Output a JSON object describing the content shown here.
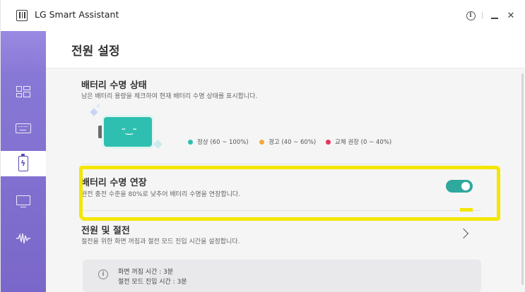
{
  "window": {
    "title": "LG Smart Assistant"
  },
  "titlebar": {
    "info_label": "i",
    "close_label": "✕"
  },
  "sidebar": {
    "items": [
      {
        "icon": "dashboard-icon",
        "active": false
      },
      {
        "icon": "keyboard-icon",
        "active": false
      },
      {
        "icon": "battery-charge-icon",
        "active": true
      },
      {
        "icon": "monitor-icon",
        "active": false
      },
      {
        "icon": "audio-wave-icon",
        "active": false
      }
    ]
  },
  "page": {
    "title": "전원 설정"
  },
  "battery_status": {
    "title": "배터리 수명 상태",
    "description": "남은 배터리 용량을 체크하여 현재 배터리 수명 상태를 표시합니다.",
    "face": "ᵕ‿ᵕ",
    "legend": [
      {
        "label": "정상 (60 ~ 100%)",
        "color": "#2fbfb0"
      },
      {
        "label": "경고 (40 ~ 60%)",
        "color": "#f2a93b"
      },
      {
        "label": "교체 권장 (0 ~ 40%)",
        "color": "#e8345a"
      }
    ]
  },
  "battery_extend": {
    "title": "배터리 수명 연장",
    "description": "완전 충전 수준을 80%로 낮추어 배터리 수명을 연장합니다.",
    "enabled": true
  },
  "power_sleep": {
    "title": "전원 및 절전",
    "description": "절전을 위한 화면 꺼짐과 절전 모드 진입 시간을 설정합니다.",
    "info_lines": [
      "화면 꺼짐 시간 : 3분",
      "절전 모드 진입 시간 : 3분"
    ]
  },
  "colors": {
    "sidebar": "#7a67c9",
    "accent": "#2fa89d",
    "highlight": "#f3e600"
  }
}
